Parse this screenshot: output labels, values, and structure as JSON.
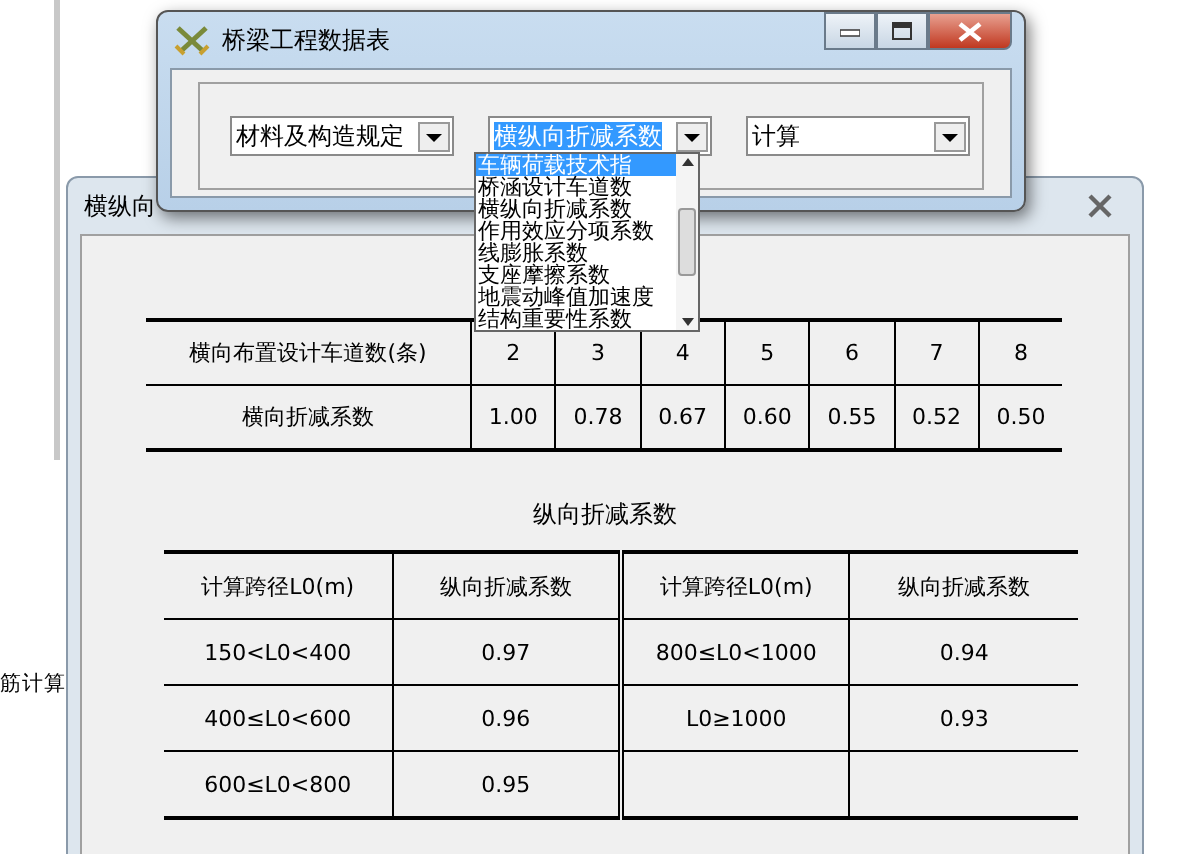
{
  "background_app": {
    "texts": [
      "筋计算"
    ]
  },
  "back_window": {
    "title": "横纵向",
    "lateral_table": {
      "header": "横向布置设计车道数(条)",
      "lanes": [
        "2",
        "3",
        "4",
        "5",
        "6",
        "7",
        "8"
      ],
      "row_label": "横向折减系数",
      "values": [
        "1.00",
        "0.78",
        "0.67",
        "0.60",
        "0.55",
        "0.52",
        "0.50"
      ]
    },
    "longitudinal_title": "纵向折减系数",
    "longitudinal_table": {
      "columns": [
        "计算跨径L0(m)",
        "纵向折减系数",
        "计算跨径L0(m)",
        "纵向折减系数"
      ],
      "rows": [
        [
          "150<L0<400",
          "0.97",
          "800≤L0<1000",
          "0.94"
        ],
        [
          "400≤L0<600",
          "0.96",
          "L0≥1000",
          "0.93"
        ],
        [
          "600≤L0<800",
          "0.95"
        ]
      ]
    }
  },
  "front_window": {
    "title": "桥梁工程数据表",
    "combos": [
      {
        "value": "材料及构造规定",
        "focused": false
      },
      {
        "value": "横纵向折减系数",
        "focused": true
      },
      {
        "value": "计算",
        "focused": false
      }
    ],
    "dropdown_items": [
      {
        "label": "车辆荷载技术指",
        "selected": true
      },
      {
        "label": "桥涵设计车道数",
        "selected": false
      },
      {
        "label": "横纵向折减系数",
        "selected": false
      },
      {
        "label": "作用效应分项系数",
        "selected": false
      },
      {
        "label": "线膨胀系数",
        "selected": false
      },
      {
        "label": "支座摩擦系数",
        "selected": false
      },
      {
        "label": "地震动峰值加速度",
        "selected": false
      },
      {
        "label": "结构重要性系数",
        "selected": false
      }
    ]
  }
}
